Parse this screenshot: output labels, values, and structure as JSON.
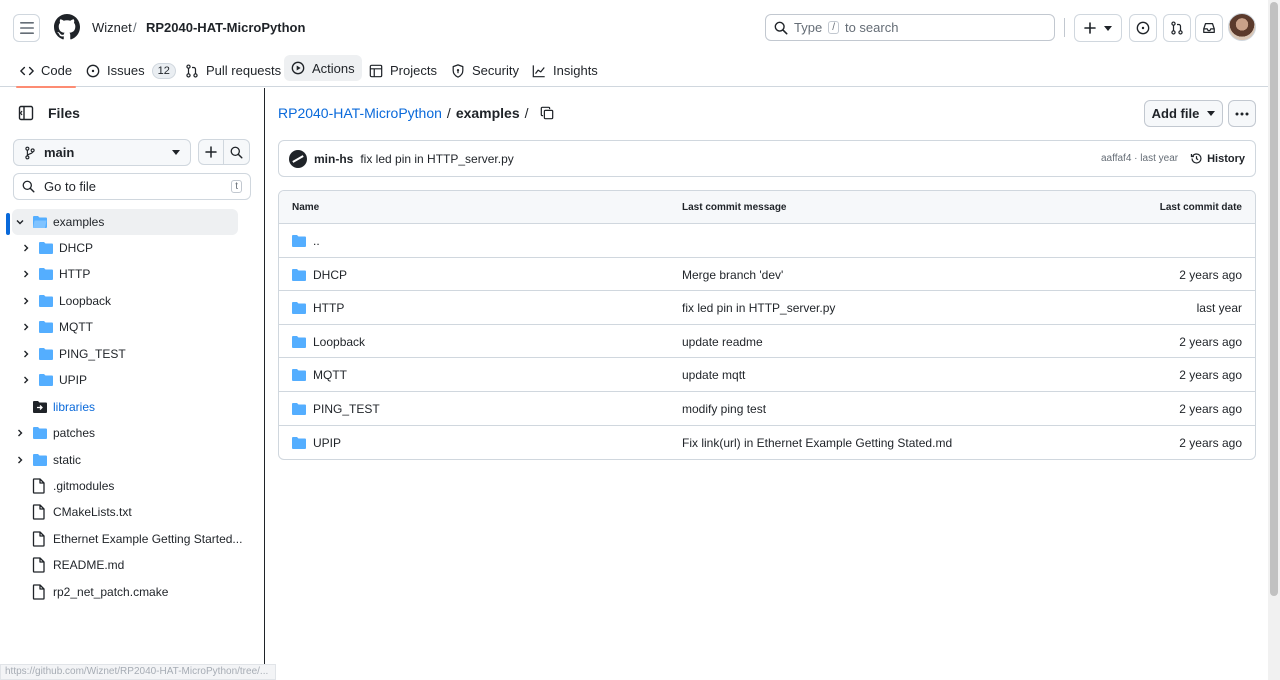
{
  "header": {
    "owner": "Wiznet",
    "separator": "/",
    "repo": "RP2040-HAT-MicroPython",
    "search_prefix": "Type",
    "search_key": "/",
    "search_suffix": "to search"
  },
  "tabs": [
    {
      "label": "Code",
      "icon": "code-icon"
    },
    {
      "label": "Issues",
      "icon": "issue-opened-icon",
      "count": "12"
    },
    {
      "label": "Pull requests",
      "icon": "git-pull-request-icon"
    },
    {
      "label": "Actions",
      "icon": "play-icon"
    },
    {
      "label": "Projects",
      "icon": "table-icon"
    },
    {
      "label": "Security",
      "icon": "shield-icon"
    },
    {
      "label": "Insights",
      "icon": "graph-icon"
    }
  ],
  "sidebar": {
    "title": "Files",
    "branch": "main",
    "goto_placeholder": "Go to file",
    "goto_key": "t",
    "tree": [
      {
        "label": "examples",
        "type": "folder-open",
        "expanded": true,
        "selected": true
      },
      {
        "label": "DHCP",
        "type": "folder"
      },
      {
        "label": "HTTP",
        "type": "folder"
      },
      {
        "label": "Loopback",
        "type": "folder"
      },
      {
        "label": "MQTT",
        "type": "folder"
      },
      {
        "label": "PING_TEST",
        "type": "folder"
      },
      {
        "label": "UPIP",
        "type": "folder"
      },
      {
        "label": "libraries",
        "type": "submodule"
      },
      {
        "label": "patches",
        "type": "folder"
      },
      {
        "label": "static",
        "type": "folder"
      },
      {
        "label": ".gitmodules",
        "type": "file"
      },
      {
        "label": "CMakeLists.txt",
        "type": "file"
      },
      {
        "label": "Ethernet Example Getting Started...",
        "type": "file"
      },
      {
        "label": "README.md",
        "type": "file"
      },
      {
        "label": "rp2_net_patch.cmake",
        "type": "file"
      }
    ]
  },
  "main": {
    "breadcrumb_repo": "RP2040-HAT-MicroPython",
    "breadcrumb_sep": "/",
    "breadcrumb_current": "examples",
    "breadcrumb_trailing": "/",
    "add_file_label": "Add file",
    "commit": {
      "author": "min-hs",
      "message": "fix led pin in HTTP_server.py",
      "meta": "aaffaf4 · last year",
      "history_label": "History"
    },
    "table": {
      "headers": {
        "name": "Name",
        "message": "Last commit message",
        "date": "Last commit date"
      },
      "rows": [
        {
          "name": "..",
          "message": "",
          "date": ""
        },
        {
          "name": "DHCP",
          "message": "Merge branch 'dev'",
          "date": "2 years ago"
        },
        {
          "name": "HTTP",
          "message": "fix led pin in HTTP_server.py",
          "date": "last year"
        },
        {
          "name": "Loopback",
          "message": "update readme",
          "date": "2 years ago"
        },
        {
          "name": "MQTT",
          "message": "update mqtt",
          "date": "2 years ago"
        },
        {
          "name": "PING_TEST",
          "message": "modify ping test",
          "date": "2 years ago"
        },
        {
          "name": "UPIP",
          "message": "Fix link(url) in Ethernet Example Getting Stated.md",
          "date": "2 years ago"
        }
      ]
    }
  },
  "status_url": "https://github.com/Wiznet/RP2040-HAT-MicroPython/tree/...",
  "colors": {
    "accent": "#0969da",
    "folder": "#54aeff",
    "tab_underline": "#fd8c73"
  }
}
